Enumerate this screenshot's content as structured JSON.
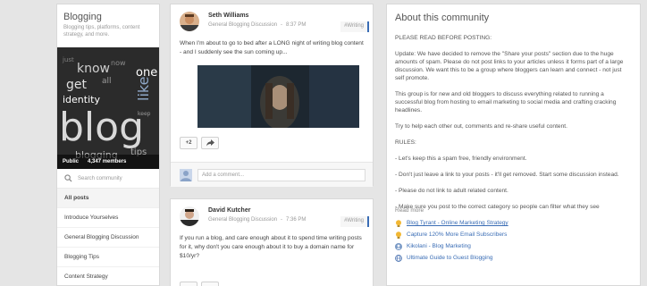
{
  "sidebar": {
    "title": "Blogging",
    "description": "Blogging tips, platforms, content strategy, and more.",
    "privacy": "Public",
    "members": "4,347 members",
    "search_placeholder": "Search community",
    "image_words": [
      "one",
      "like",
      "know",
      "get",
      "identity",
      "blog",
      "blogging",
      "tips",
      "keep",
      "now",
      "all",
      "just"
    ],
    "nav": [
      {
        "label": "All posts"
      },
      {
        "label": "Introduce Yourselves"
      },
      {
        "label": "General Blogging Discussion"
      },
      {
        "label": "Blogging Tips"
      },
      {
        "label": "Content Strategy"
      }
    ]
  },
  "posts": [
    {
      "author": "Seth Williams",
      "category": "General Blogging Discussion",
      "time": "8:37 PM",
      "tag": "#Writing",
      "text": "When I'm about to go to bed after a LONG night of writing blog content - and I suddenly see the sun coming up...",
      "plus_count": "+2",
      "comment_placeholder": "Add a comment..."
    },
    {
      "author": "David Kutcher",
      "category": "General Blogging Discussion",
      "time": "7:36 PM",
      "tag": "#Writing",
      "text": "If you run a blog, and care enough about it to spend time writing posts for it, why don't you care enough about it to buy a domain name for $10/yr?"
    }
  ],
  "about": {
    "title": "About this community",
    "paragraphs": [
      "PLEASE READ BEFORE POSTING:",
      "Update: We have decided to remove the \"Share your posts\" section due to the huge amounts of spam. Please do not post links to your articles unless it forms part of a large discussion. We want this to be a group where bloggers can learn and connect - not just self promote.",
      "This group is for new and old bloggers to discuss everything related to running a successful blog from hosting to email marketing to social media and crafting cracking headlines.",
      "Try to help each other out, comments and re-share useful content.",
      "RULES:",
      "- Let's keep this a spam free, friendly environment.",
      "- Don't just leave a link to your posts - it'll get removed. Start some discussion instead.",
      "- Please do not link to adult related content.",
      "- Make sure you post to the correct category so people can filter what they see"
    ],
    "read_more": "Read more",
    "links": [
      {
        "label": "Blog Tyrant - Online Marketing Strategy",
        "icon": "lightbulb-icon"
      },
      {
        "label": "Capture 120% More Email Subscribers",
        "icon": "lightbulb-icon"
      },
      {
        "label": "Kikolani - Blog Marketing",
        "icon": "person-icon"
      },
      {
        "label": "Ultimate Guide to Guest Blogging",
        "icon": "globe-icon"
      }
    ]
  },
  "colors": {
    "page_bg": "#e5e5e5",
    "link": "#3a6db5",
    "tag_accent": "#3a6db5"
  }
}
